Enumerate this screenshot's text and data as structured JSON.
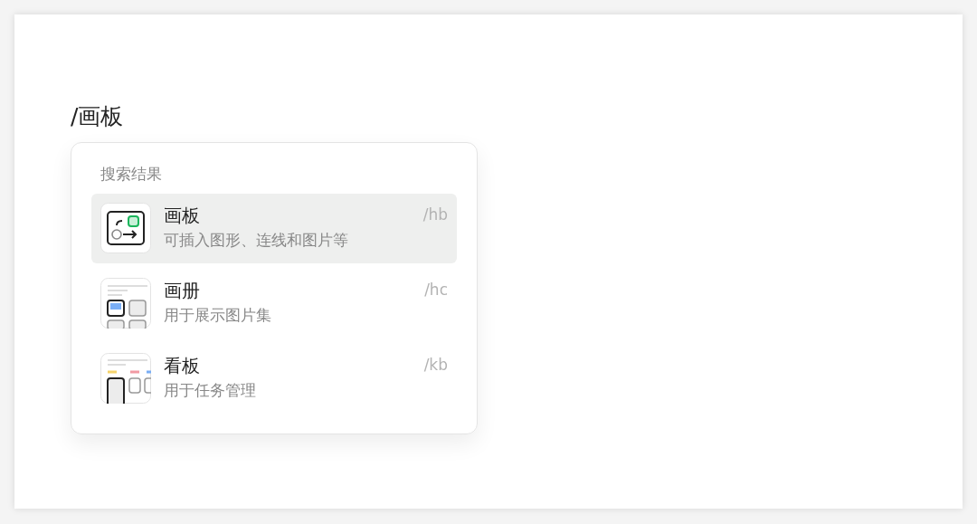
{
  "editor": {
    "typed_text": "/画板"
  },
  "menu": {
    "heading": "搜索结果",
    "items": [
      {
        "kind": "board",
        "title": "画板",
        "description": "可插入图形、连线和图片等",
        "shortcut": "/hb",
        "selected": true
      },
      {
        "kind": "album",
        "title": "画册",
        "description": "用于展示图片集",
        "shortcut": "/hc",
        "selected": false
      },
      {
        "kind": "kanban",
        "title": "看板",
        "description": "用于任务管理",
        "shortcut": "/kb",
        "selected": false
      }
    ]
  }
}
